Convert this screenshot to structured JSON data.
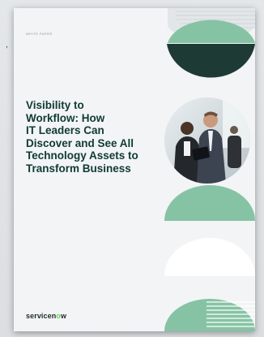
{
  "cover": {
    "eyebrow": "WHITE PAPER",
    "title_lines": [
      "Visibility to",
      "Workflow: How",
      "IT Leaders Can",
      "Discover and See All",
      "Technology Assets to",
      "Transform Business"
    ],
    "logo": {
      "text_before": "servicen",
      "text_accent": "o",
      "text_after": "w"
    }
  },
  "edge_glyph": ",",
  "photo": {
    "icon": "business-people-photo"
  },
  "colors": {
    "title": "#0f3b32",
    "dark_green": "#1e3a34",
    "mint": "#86c3a4",
    "logo_accent": "#62d84e"
  }
}
